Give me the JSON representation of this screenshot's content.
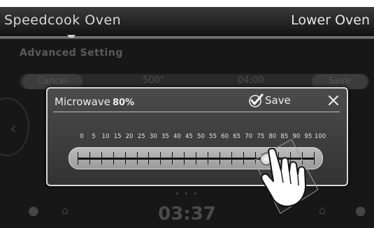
{
  "header": {
    "left_tab": "Speedcook Oven",
    "right_tab": "Lower Oven"
  },
  "background": {
    "section_title": "Advanced Setting",
    "cancel_label": "Cancel",
    "temperature": "500°",
    "cook_time": "04:00",
    "save_label": "Save",
    "dots": "• • •",
    "clock": "03:37"
  },
  "dialog": {
    "title": "Microwave",
    "power_value": "80%",
    "save_label": "Save",
    "scale_labels": [
      "0",
      "5",
      "10",
      "15",
      "20",
      "25",
      "30",
      "35",
      "40",
      "45",
      "50",
      "55",
      "60",
      "65",
      "70",
      "75",
      "80",
      "85",
      "90",
      "95",
      "100"
    ],
    "slider_value": 80
  },
  "icons": {
    "save": "checkmark-icon",
    "close": "close-icon",
    "hand": "hand-pointer-icon",
    "lightbulb": "lightbulb-icon",
    "lock": "lock-icon"
  }
}
